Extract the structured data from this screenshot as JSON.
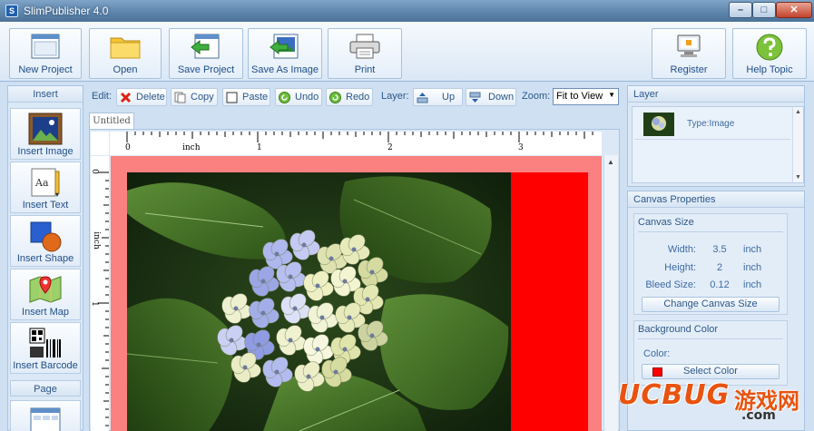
{
  "window": {
    "title": "SlimPublisher 4.0",
    "app_icon_glyph": "S",
    "min": "–",
    "max": "□",
    "close": "✕"
  },
  "toolbar": {
    "new_project": "New Project",
    "open": "Open",
    "save_project": "Save Project",
    "save_as_image": "Save As Image",
    "print": "Print",
    "register": "Register",
    "help_topic": "Help Topic"
  },
  "insert_panel": {
    "title": "Insert",
    "items": [
      "Insert Image",
      "Insert Text",
      "Insert Shape",
      "Insert Map",
      "Insert Barcode"
    ],
    "page_title": "Page"
  },
  "edit_toolbar": {
    "edit_label": "Edit:",
    "delete": "Delete",
    "copy": "Copy",
    "paste": "Paste",
    "undo": "Undo",
    "redo": "Redo",
    "layer_label": "Layer:",
    "up": "Up",
    "down": "Down",
    "zoom_label": "Zoom:",
    "zoom_value": "Fit to View"
  },
  "document": {
    "tab": "Untitled",
    "ruler_unit": "inch",
    "h_ruler_numbers": [
      "0",
      "1",
      "2",
      "3"
    ],
    "v_ruler_numbers": [
      "0",
      "1"
    ]
  },
  "layer_panel": {
    "title": "Layer",
    "item_type": "Type:Image"
  },
  "canvas_properties": {
    "title": "Canvas Properties",
    "size_group": "Canvas Size",
    "width_label": "Width:",
    "width_value": "3.5",
    "height_label": "Height:",
    "height_value": "2",
    "bleed_label": "Bleed Size:",
    "bleed_value": "0.12",
    "unit": "inch",
    "change_button": "Change Canvas Size",
    "bg_group": "Background Color",
    "color_label": "Color:",
    "select_color_button": "Select Color",
    "bg_color": "#ff0000"
  },
  "watermark": {
    "brand": "UCBUG",
    "cn": "游戏网",
    "domain": ".com"
  }
}
